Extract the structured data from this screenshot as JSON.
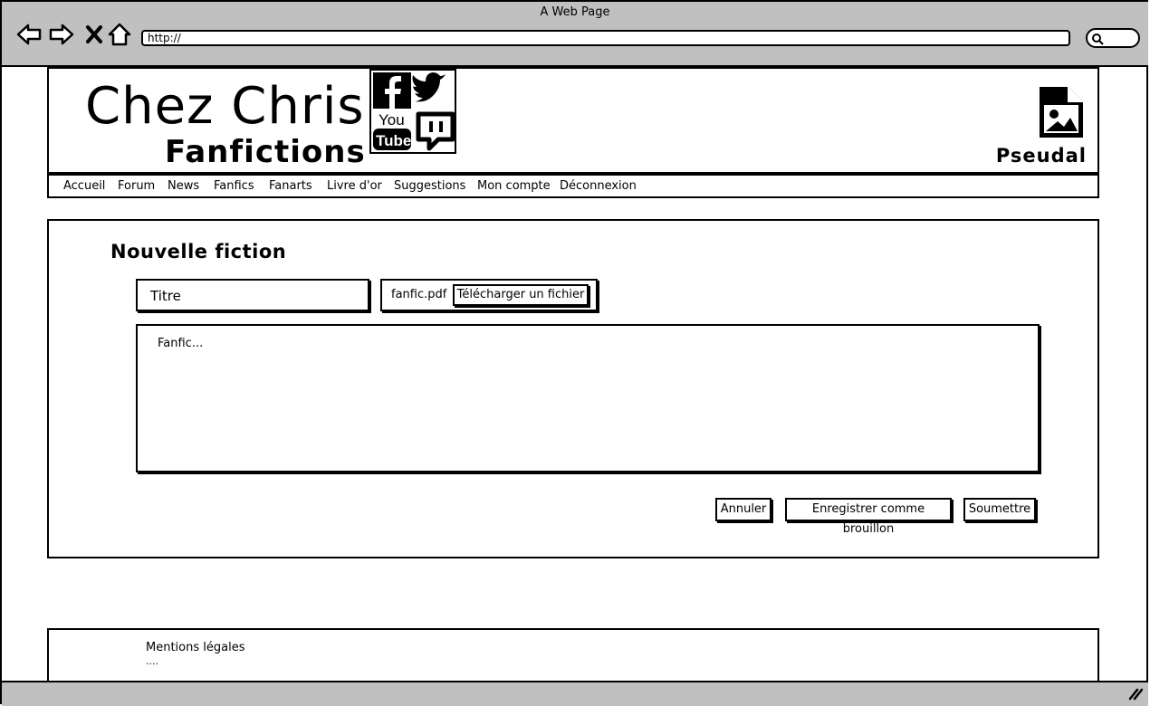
{
  "window": {
    "title": "A Web Page"
  },
  "browser": {
    "url": "http://",
    "icons": [
      "back-arrow-icon",
      "forward-arrow-icon",
      "close-x-icon",
      "home-icon",
      "search-icon",
      "resize-grip-icon"
    ]
  },
  "header": {
    "site_title": "Chez Chris",
    "site_subtitle": "Fanfictions",
    "social_icons": [
      "facebook-icon",
      "twitter-icon",
      "youtube-icon",
      "twitch-icon"
    ],
    "youtube_logo_text": [
      "You",
      "Tube"
    ],
    "profile_icon": "image-icon",
    "username": "Pseudal"
  },
  "menu": {
    "items": [
      {
        "label": "Accueil"
      },
      {
        "label": "Forum"
      },
      {
        "label": "News"
      },
      {
        "label": "Fanfics"
      },
      {
        "label": "Fanarts"
      },
      {
        "label": "Livre d'or"
      },
      {
        "label": "Suggestions"
      },
      {
        "label": "Mon compte"
      },
      {
        "label": "Déconnexion"
      }
    ]
  },
  "form": {
    "page_title": "Nouvelle fiction",
    "title_placeholder": "Titre",
    "file_name": "fanfic.pdf",
    "upload_label": "Télécharger un fichier",
    "content_placeholder": "Fanfic...",
    "cancel_label": "Annuler",
    "draft_label": "Enregistrer comme brouillon",
    "submit_label": "Soumettre"
  },
  "footer": {
    "legal_label": "Mentions légales",
    "dots": "...."
  }
}
